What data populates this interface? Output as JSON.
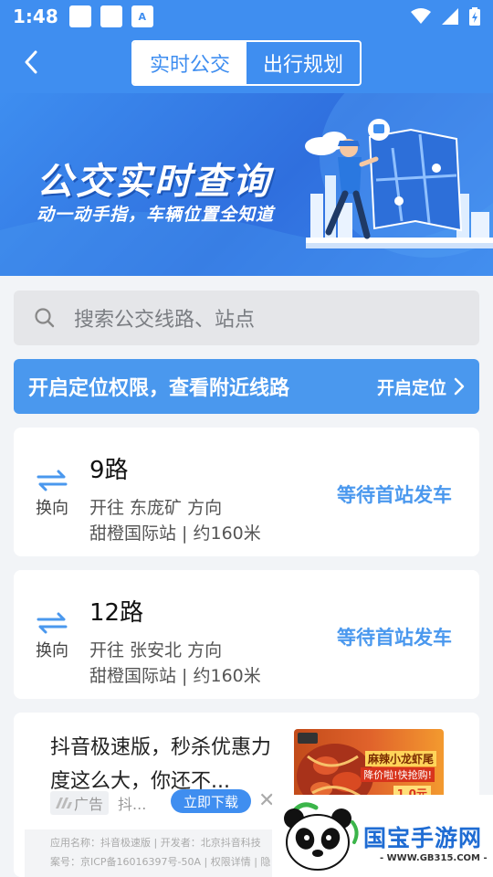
{
  "status_bar": {
    "time": "1:48",
    "notif_icon_text": "A"
  },
  "header": {
    "tabs": [
      "实时公交",
      "出行规划"
    ],
    "active_tab": 0
  },
  "banner": {
    "title": "公交实时查询",
    "subtitle": "动一动手指，车辆位置全知道"
  },
  "search": {
    "placeholder": "搜索公交线路、站点"
  },
  "location": {
    "message": "开启定位权限，查看附近线路",
    "button": "开启定位"
  },
  "routes": [
    {
      "name": "9路",
      "direction": "开往 东庞矿 方向",
      "stop": "甜橙国际站 | 约160米",
      "status": "等待首站发车",
      "swap_label": "换向"
    },
    {
      "name": "12路",
      "direction": "开往 张安北 方向",
      "stop": "甜橙国际站 | 约160米",
      "status": "等待首站发车",
      "swap_label": "换向"
    }
  ],
  "ad": {
    "headline": "抖音极速版，秒杀优惠力度这么大，你还不...",
    "tag": "广告",
    "app_short": "抖...",
    "download": "立即下载",
    "thumb_title": "麻辣小龙虾尾",
    "thumb_sub": "降价啦!快抢购!",
    "thumb_price": "1.0元",
    "footer_line1": "应用名称：抖音极速版 | 开发者：北京抖音科技",
    "footer_line2": "案号：京ICP备16016397号-50A | 权限详情 | 隐"
  },
  "watermark": {
    "text": "国宝手游网",
    "url": "- WWW.GB315.COM -"
  },
  "colors": {
    "primary": "#3f8ef0",
    "location_bar": "#4a98ee",
    "status_text": "#4a98ee"
  }
}
